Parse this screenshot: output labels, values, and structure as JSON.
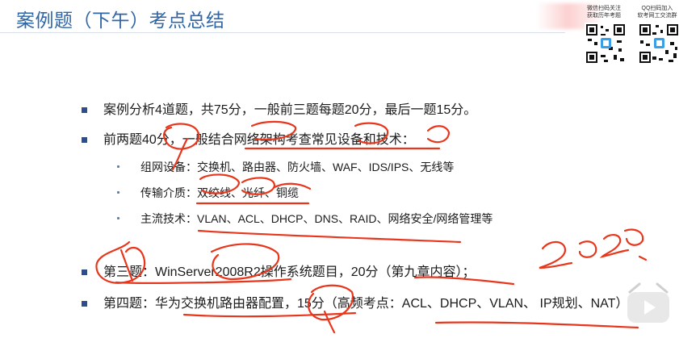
{
  "slide": {
    "title": "案例题（下午）考点总结",
    "qr_left_caption": "微信扫码关注\n获取历年考题",
    "qr_right_caption": "QQ扫码加入\n软考网工交流群",
    "points": [
      "案例分析4道题，共75分，一般前三题每题20分，最后一题15分。",
      "前两题40分，一般结合网络架构考查常见设备和技术：",
      "第三题：WinServer2008R2操作系统题目，20分（第九章内容）；",
      "第四题：华为交换机路由器配置，15分（高频考点：ACL、DHCP、VLAN、 IP规划、NAT）"
    ],
    "subpoints": [
      "组网设备：交换机、路由器、防火墙、WAF、IDS/IPS、无线等",
      "传输介质：双绞线、光纤、铜缆",
      "主流技术：VLAN、ACL、DHCP、DNS、RAID、网络安全/网络管理等"
    ]
  },
  "colors": {
    "title": "#2f66a8",
    "bullet": "#2a4f8a",
    "ink": "#e8361c"
  }
}
